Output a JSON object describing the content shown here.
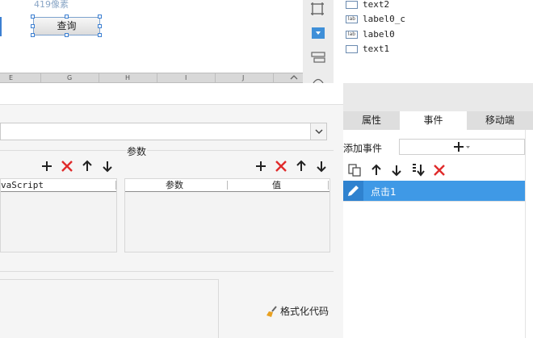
{
  "canvas": {
    "size_hint": "419像素",
    "query_button": "查询",
    "columns": [
      "E",
      "G",
      "H",
      "I",
      "J"
    ]
  },
  "component_tree": {
    "items": [
      {
        "label": "text2",
        "icon": "textbox-icon",
        "icon_text": ""
      },
      {
        "label": "label0_c",
        "icon": "label-icon",
        "icon_text": "lab"
      },
      {
        "label": "label0",
        "icon": "label-icon",
        "icon_text": "lab"
      },
      {
        "label": "text1",
        "icon": "textbox-icon",
        "icon_text": ""
      }
    ]
  },
  "dialog": {
    "params_label": "参数",
    "js_table": {
      "header": "vaScript"
    },
    "param_table": {
      "headers": [
        "参数",
        "值"
      ]
    },
    "format_code_label": "格式化代码"
  },
  "event_panel": {
    "tabs": [
      "属性",
      "事件",
      "移动端"
    ],
    "active_tab": "事件",
    "add_event_label": "添加事件",
    "events": [
      {
        "label": "点击1",
        "selected": true
      }
    ]
  },
  "colors": {
    "accent": "#3f99e6",
    "delete_red": "#e02b2b",
    "selection_blue": "#3c7fd1"
  }
}
